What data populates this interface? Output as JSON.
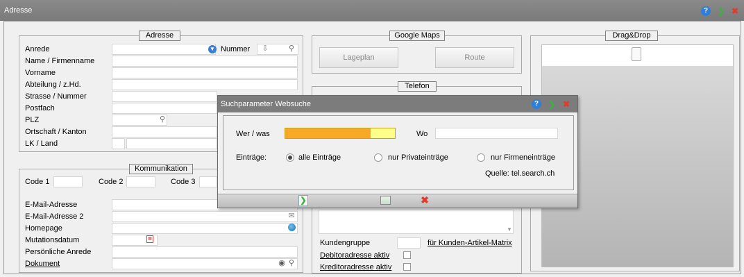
{
  "window": {
    "title": "Adresse"
  },
  "adresse": {
    "legend": "Adresse",
    "anrede": "Anrede",
    "nummer": "Nummer",
    "name": "Name / Firmenname",
    "vorname": "Vorname",
    "abteilung": "Abteilung / z.Hd.",
    "strasse": "Strasse / Nummer",
    "postfach": "Postfach",
    "plz": "PLZ",
    "ortschaft": "Ortschaft / Kanton",
    "lk": "LK / Land"
  },
  "kommunikation": {
    "legend": "Kommunikation",
    "code1": "Code 1",
    "code2": "Code 2",
    "code3": "Code 3",
    "email": "E-Mail-Adresse",
    "email2": "E-Mail-Adresse 2",
    "homepage": "Homepage",
    "mutationsdatum": "Mutationsdatum",
    "anrede_persoenlich": "Persönliche Anrede",
    "dokument": "Dokument"
  },
  "google": {
    "legend": "Google Maps",
    "lageplan": "Lageplan",
    "route": "Route"
  },
  "telefon": {
    "legend": "Telefon"
  },
  "kunden": {
    "kundengruppe": "Kundengruppe",
    "matrix_link": "für Kunden-Artikel-Matrix",
    "debitor": "Debitoradresse aktiv",
    "kreditor": "Kreditoradresse aktiv"
  },
  "dragdrop": {
    "legend": "Drag&Drop"
  },
  "dialog": {
    "title": "Suchparameter Websuche",
    "wer_label": "Wer / was",
    "wo_label": "Wo",
    "eintraege_label": "Einträge:",
    "opt_alle": "alle Einträge",
    "opt_privat": "nur Privateinträge",
    "opt_firmen": "nur Firmeneinträge",
    "quelle": "Quelle: tel.search.ch"
  },
  "colors": {
    "search_highlight": "#f7a824",
    "search_highlight_light": "#ffff8a"
  }
}
